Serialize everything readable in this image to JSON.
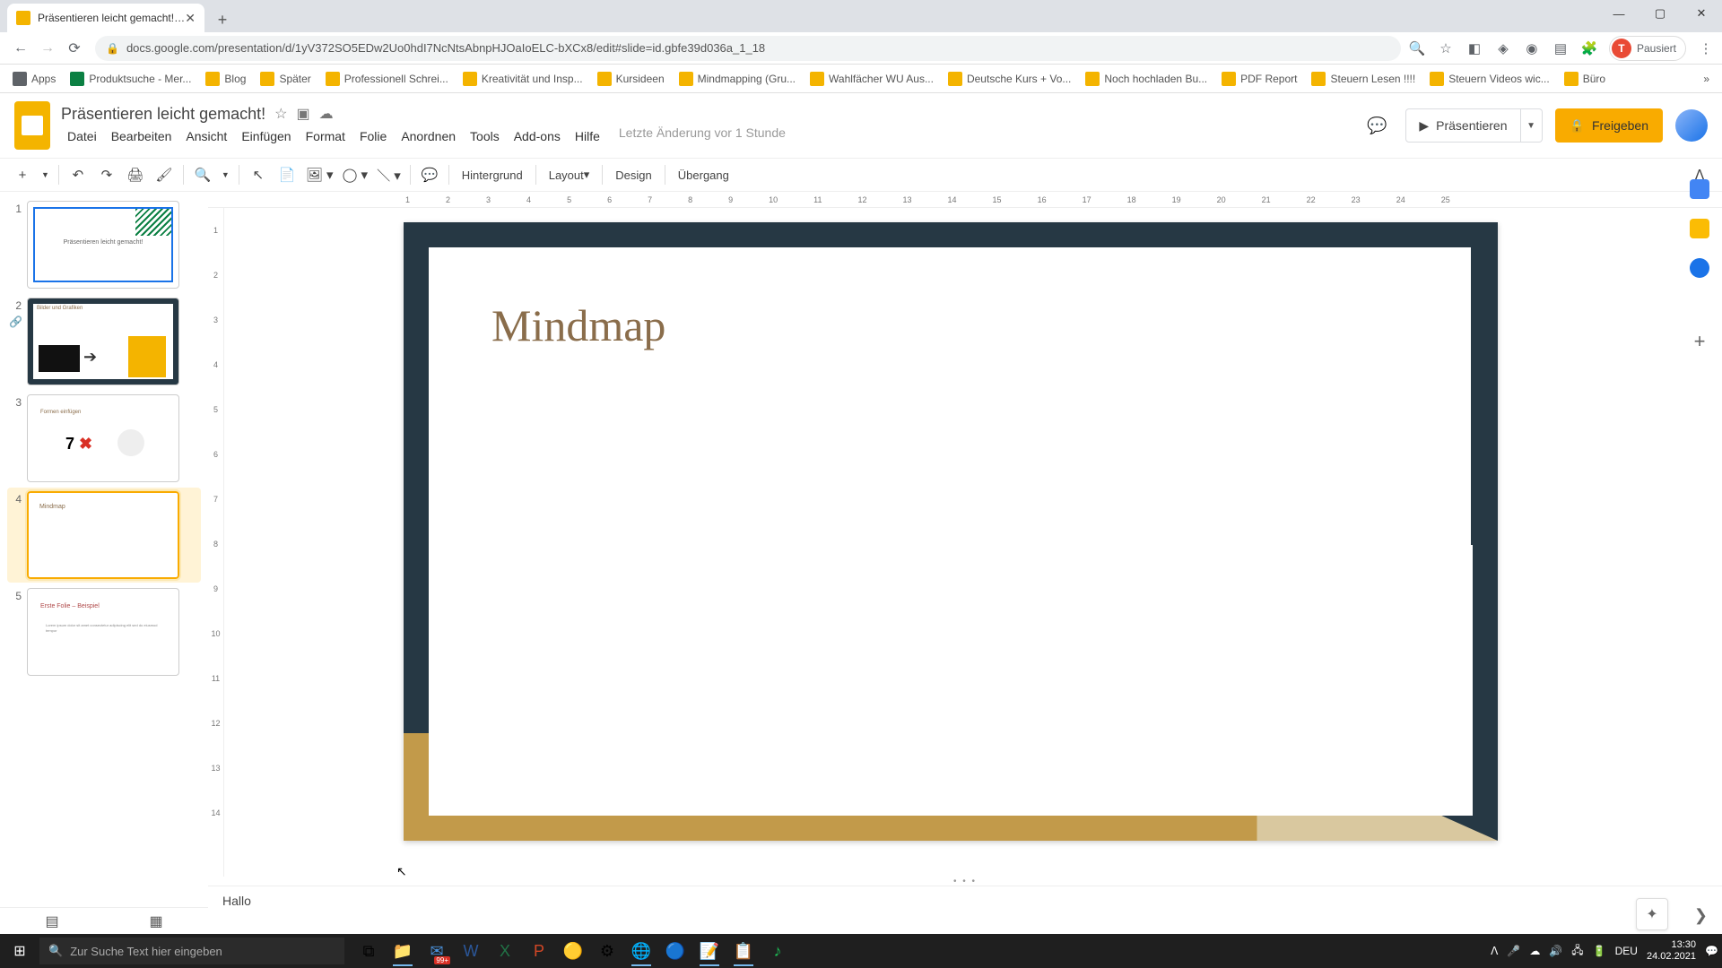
{
  "browser": {
    "tab_title": "Präsentieren leicht gemacht! - G",
    "url": "docs.google.com/presentation/d/1yV372SO5EDw2Uo0hdI7NcNtsAbnpHJOaIoELC-bXCx8/edit#slide=id.gbfe39d036a_1_18",
    "profile_status": "Pausiert",
    "profile_initial": "T"
  },
  "bookmarks": {
    "items": [
      "Apps",
      "Produktsuche - Mer...",
      "Blog",
      "Später",
      "Professionell Schrei...",
      "Kreativität und Insp...",
      "Kursideen",
      "Mindmapping  (Gru...",
      "Wahlfächer WU Aus...",
      "Deutsche Kurs + Vo...",
      "Noch hochladen Bu...",
      "PDF Report",
      "Steuern Lesen !!!!",
      "Steuern Videos wic...",
      "Büro"
    ]
  },
  "doc": {
    "title": "Präsentieren leicht gemacht!",
    "menus": [
      "Datei",
      "Bearbeiten",
      "Ansicht",
      "Einfügen",
      "Format",
      "Folie",
      "Anordnen",
      "Tools",
      "Add-ons",
      "Hilfe"
    ],
    "last_edit": "Letzte Änderung vor 1 Stunde",
    "present": "Präsentieren",
    "share": "Freigeben"
  },
  "toolbar": {
    "background": "Hintergrund",
    "layout": "Layout",
    "design": "Design",
    "transition": "Übergang"
  },
  "ruler_h": [
    "1",
    "2",
    "3",
    "4",
    "5",
    "6",
    "7",
    "8",
    "9",
    "10",
    "11",
    "12",
    "13",
    "14",
    "15",
    "16",
    "17",
    "18",
    "19",
    "20",
    "21",
    "22",
    "23",
    "24",
    "25"
  ],
  "ruler_v": [
    "1",
    "2",
    "3",
    "4",
    "5",
    "6",
    "7",
    "8",
    "9",
    "10",
    "11",
    "12",
    "13",
    "14"
  ],
  "slide": {
    "title": "Mindmap"
  },
  "thumbs": {
    "t1": "Präsentieren leicht gemacht!",
    "t2": "Bilder und Grafiken",
    "t3_label": "Formen einfügen",
    "t3_seven": "7",
    "t3_x": "✖",
    "t4": "Mindmap",
    "t5_title": "Erste Folie – Beispiel",
    "t5_body": "Lorem ipsum dolor sit amet consectetur adipiscing elit sed do eiusmod tempor"
  },
  "notes": "Hallo",
  "taskbar": {
    "search_placeholder": "Zur Suche Text hier eingeben",
    "lang": "DEU",
    "time": "13:30",
    "date": "24.02.2021",
    "mail_badge": "99+"
  }
}
